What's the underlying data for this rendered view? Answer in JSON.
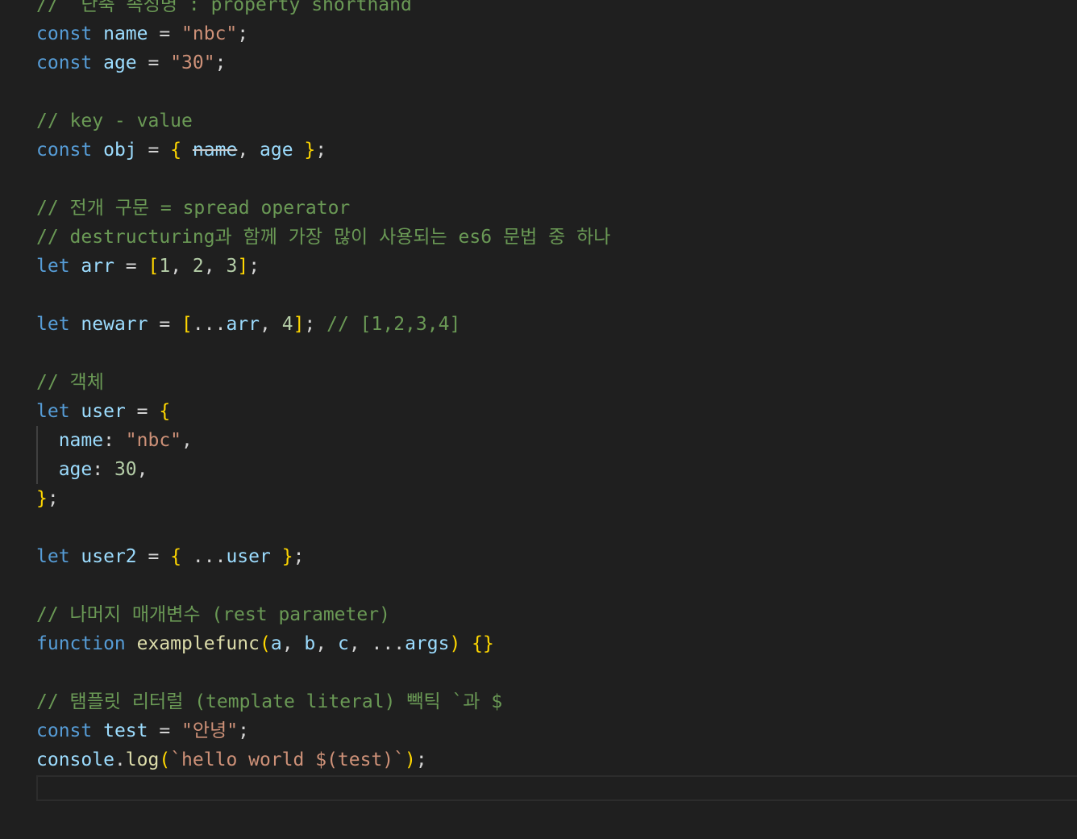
{
  "colors": {
    "background": "#1f1f1f",
    "keyword": "#569cd6",
    "variable": "#9cdcfe",
    "string": "#ce9178",
    "number": "#b5cea8",
    "comment": "#6a9955",
    "function": "#dcdcaa",
    "bracket": "#ffd700",
    "punctuation": "#d4d4d4"
  },
  "lines": [
    [
      [
        "cmt",
        "//  단축 속성명 : property shorthand"
      ]
    ],
    [
      [
        "kw",
        "const"
      ],
      [
        "p",
        " "
      ],
      [
        "var",
        "name"
      ],
      [
        "p",
        " = "
      ],
      [
        "str",
        "\"nbc\""
      ],
      [
        "p",
        ";"
      ]
    ],
    [
      [
        "kw",
        "const"
      ],
      [
        "p",
        " "
      ],
      [
        "var",
        "age"
      ],
      [
        "p",
        " = "
      ],
      [
        "str",
        "\"30\""
      ],
      [
        "p",
        ";"
      ]
    ],
    [],
    [
      [
        "cmt",
        "// key - value"
      ]
    ],
    [
      [
        "kw",
        "const"
      ],
      [
        "p",
        " "
      ],
      [
        "var",
        "obj"
      ],
      [
        "p",
        " = "
      ],
      [
        "br1",
        "{"
      ],
      [
        "p",
        " "
      ],
      [
        "strike",
        "name"
      ],
      [
        "p",
        ", "
      ],
      [
        "var",
        "age"
      ],
      [
        "p",
        " "
      ],
      [
        "br1",
        "}"
      ],
      [
        "p",
        ";"
      ]
    ],
    [],
    [
      [
        "cmt",
        "// 전개 구문 = spread operator"
      ]
    ],
    [
      [
        "cmt",
        "// destructuring과 함께 가장 많이 사용되는 es6 문법 중 하나"
      ]
    ],
    [
      [
        "kw",
        "let"
      ],
      [
        "p",
        " "
      ],
      [
        "var",
        "arr"
      ],
      [
        "p",
        " = "
      ],
      [
        "br1",
        "["
      ],
      [
        "num",
        "1"
      ],
      [
        "p",
        ", "
      ],
      [
        "num",
        "2"
      ],
      [
        "p",
        ", "
      ],
      [
        "num",
        "3"
      ],
      [
        "br1",
        "]"
      ],
      [
        "p",
        ";"
      ]
    ],
    [],
    [
      [
        "kw",
        "let"
      ],
      [
        "p",
        " "
      ],
      [
        "var",
        "newarr"
      ],
      [
        "p",
        " = "
      ],
      [
        "br1",
        "["
      ],
      [
        "p",
        "..."
      ],
      [
        "var",
        "arr"
      ],
      [
        "p",
        ", "
      ],
      [
        "num",
        "4"
      ],
      [
        "br1",
        "]"
      ],
      [
        "p",
        "; "
      ],
      [
        "cmt",
        "// [1,2,3,4]"
      ]
    ],
    [],
    [
      [
        "cmt",
        "// 객체"
      ]
    ],
    [
      [
        "kw",
        "let"
      ],
      [
        "p",
        " "
      ],
      [
        "var",
        "user"
      ],
      [
        "p",
        " = "
      ],
      [
        "br1",
        "{"
      ]
    ],
    [
      [
        "p",
        "  "
      ],
      [
        "var",
        "name"
      ],
      [
        "p",
        ": "
      ],
      [
        "str",
        "\"nbc\""
      ],
      [
        "p",
        ","
      ]
    ],
    [
      [
        "p",
        "  "
      ],
      [
        "var",
        "age"
      ],
      [
        "p",
        ": "
      ],
      [
        "num",
        "30"
      ],
      [
        "p",
        ","
      ]
    ],
    [
      [
        "br1",
        "}"
      ],
      [
        "p",
        ";"
      ]
    ],
    [],
    [
      [
        "kw",
        "let"
      ],
      [
        "p",
        " "
      ],
      [
        "var",
        "user2"
      ],
      [
        "p",
        " = "
      ],
      [
        "br1",
        "{"
      ],
      [
        "p",
        " ..."
      ],
      [
        "var",
        "user"
      ],
      [
        "p",
        " "
      ],
      [
        "br1",
        "}"
      ],
      [
        "p",
        ";"
      ]
    ],
    [],
    [
      [
        "cmt",
        "// 나머지 매개변수 (rest parameter)"
      ]
    ],
    [
      [
        "kw",
        "function"
      ],
      [
        "p",
        " "
      ],
      [
        "fn",
        "examplefunc"
      ],
      [
        "br1",
        "("
      ],
      [
        "param",
        "a"
      ],
      [
        "p",
        ", "
      ],
      [
        "param",
        "b"
      ],
      [
        "p",
        ", "
      ],
      [
        "param",
        "c"
      ],
      [
        "p",
        ", ..."
      ],
      [
        "param",
        "args"
      ],
      [
        "br1",
        ")"
      ],
      [
        "p",
        " "
      ],
      [
        "br1",
        "{}"
      ]
    ],
    [],
    [
      [
        "cmt",
        "// 탬플릿 리터럴 (template literal) 빽틱 `과 $"
      ]
    ],
    [
      [
        "kw",
        "const"
      ],
      [
        "p",
        " "
      ],
      [
        "var",
        "test"
      ],
      [
        "p",
        " = "
      ],
      [
        "str",
        "\"안녕\""
      ],
      [
        "p",
        ";"
      ]
    ],
    [
      [
        "var",
        "console"
      ],
      [
        "p",
        "."
      ],
      [
        "fn",
        "log"
      ],
      [
        "br1",
        "("
      ],
      [
        "str",
        "`hello world $(test)`"
      ],
      [
        "br1",
        ")"
      ],
      [
        "p",
        ";"
      ]
    ]
  ]
}
